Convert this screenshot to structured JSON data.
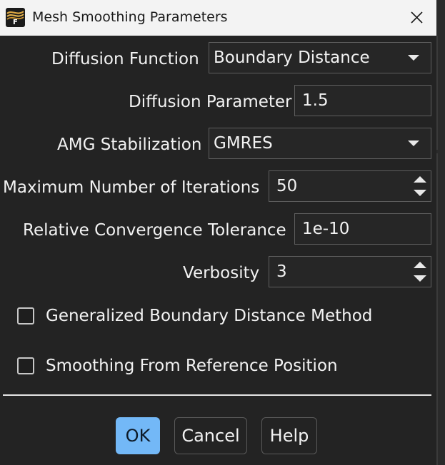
{
  "window": {
    "title": "Mesh Smoothing Parameters",
    "icon": "fluent-logo-icon",
    "icon_letter": "F"
  },
  "form": {
    "diffusion_function": {
      "label": "Diffusion Function",
      "value": "Boundary Distance"
    },
    "diffusion_parameter": {
      "label": "Diffusion Parameter",
      "value": "1.5"
    },
    "amg_stabilization": {
      "label": "AMG Stabilization",
      "value": "GMRES"
    },
    "max_iterations": {
      "label": "Maximum Number of Iterations",
      "value": "50"
    },
    "relative_tolerance": {
      "label": "Relative Convergence Tolerance",
      "value": "1e-10"
    },
    "verbosity": {
      "label": "Verbosity",
      "value": "3"
    },
    "generalized_boundary": {
      "label": "Generalized Boundary Distance Method",
      "checked": false
    },
    "smoothing_reference": {
      "label": "Smoothing From Reference Position",
      "checked": false
    }
  },
  "buttons": {
    "ok": "OK",
    "cancel": "Cancel",
    "help": "Help"
  },
  "colors": {
    "background": "#232323",
    "titlebar": "#f3f3f3",
    "ok_button": "#73b8f7",
    "field_border": "#5e5e5e"
  }
}
